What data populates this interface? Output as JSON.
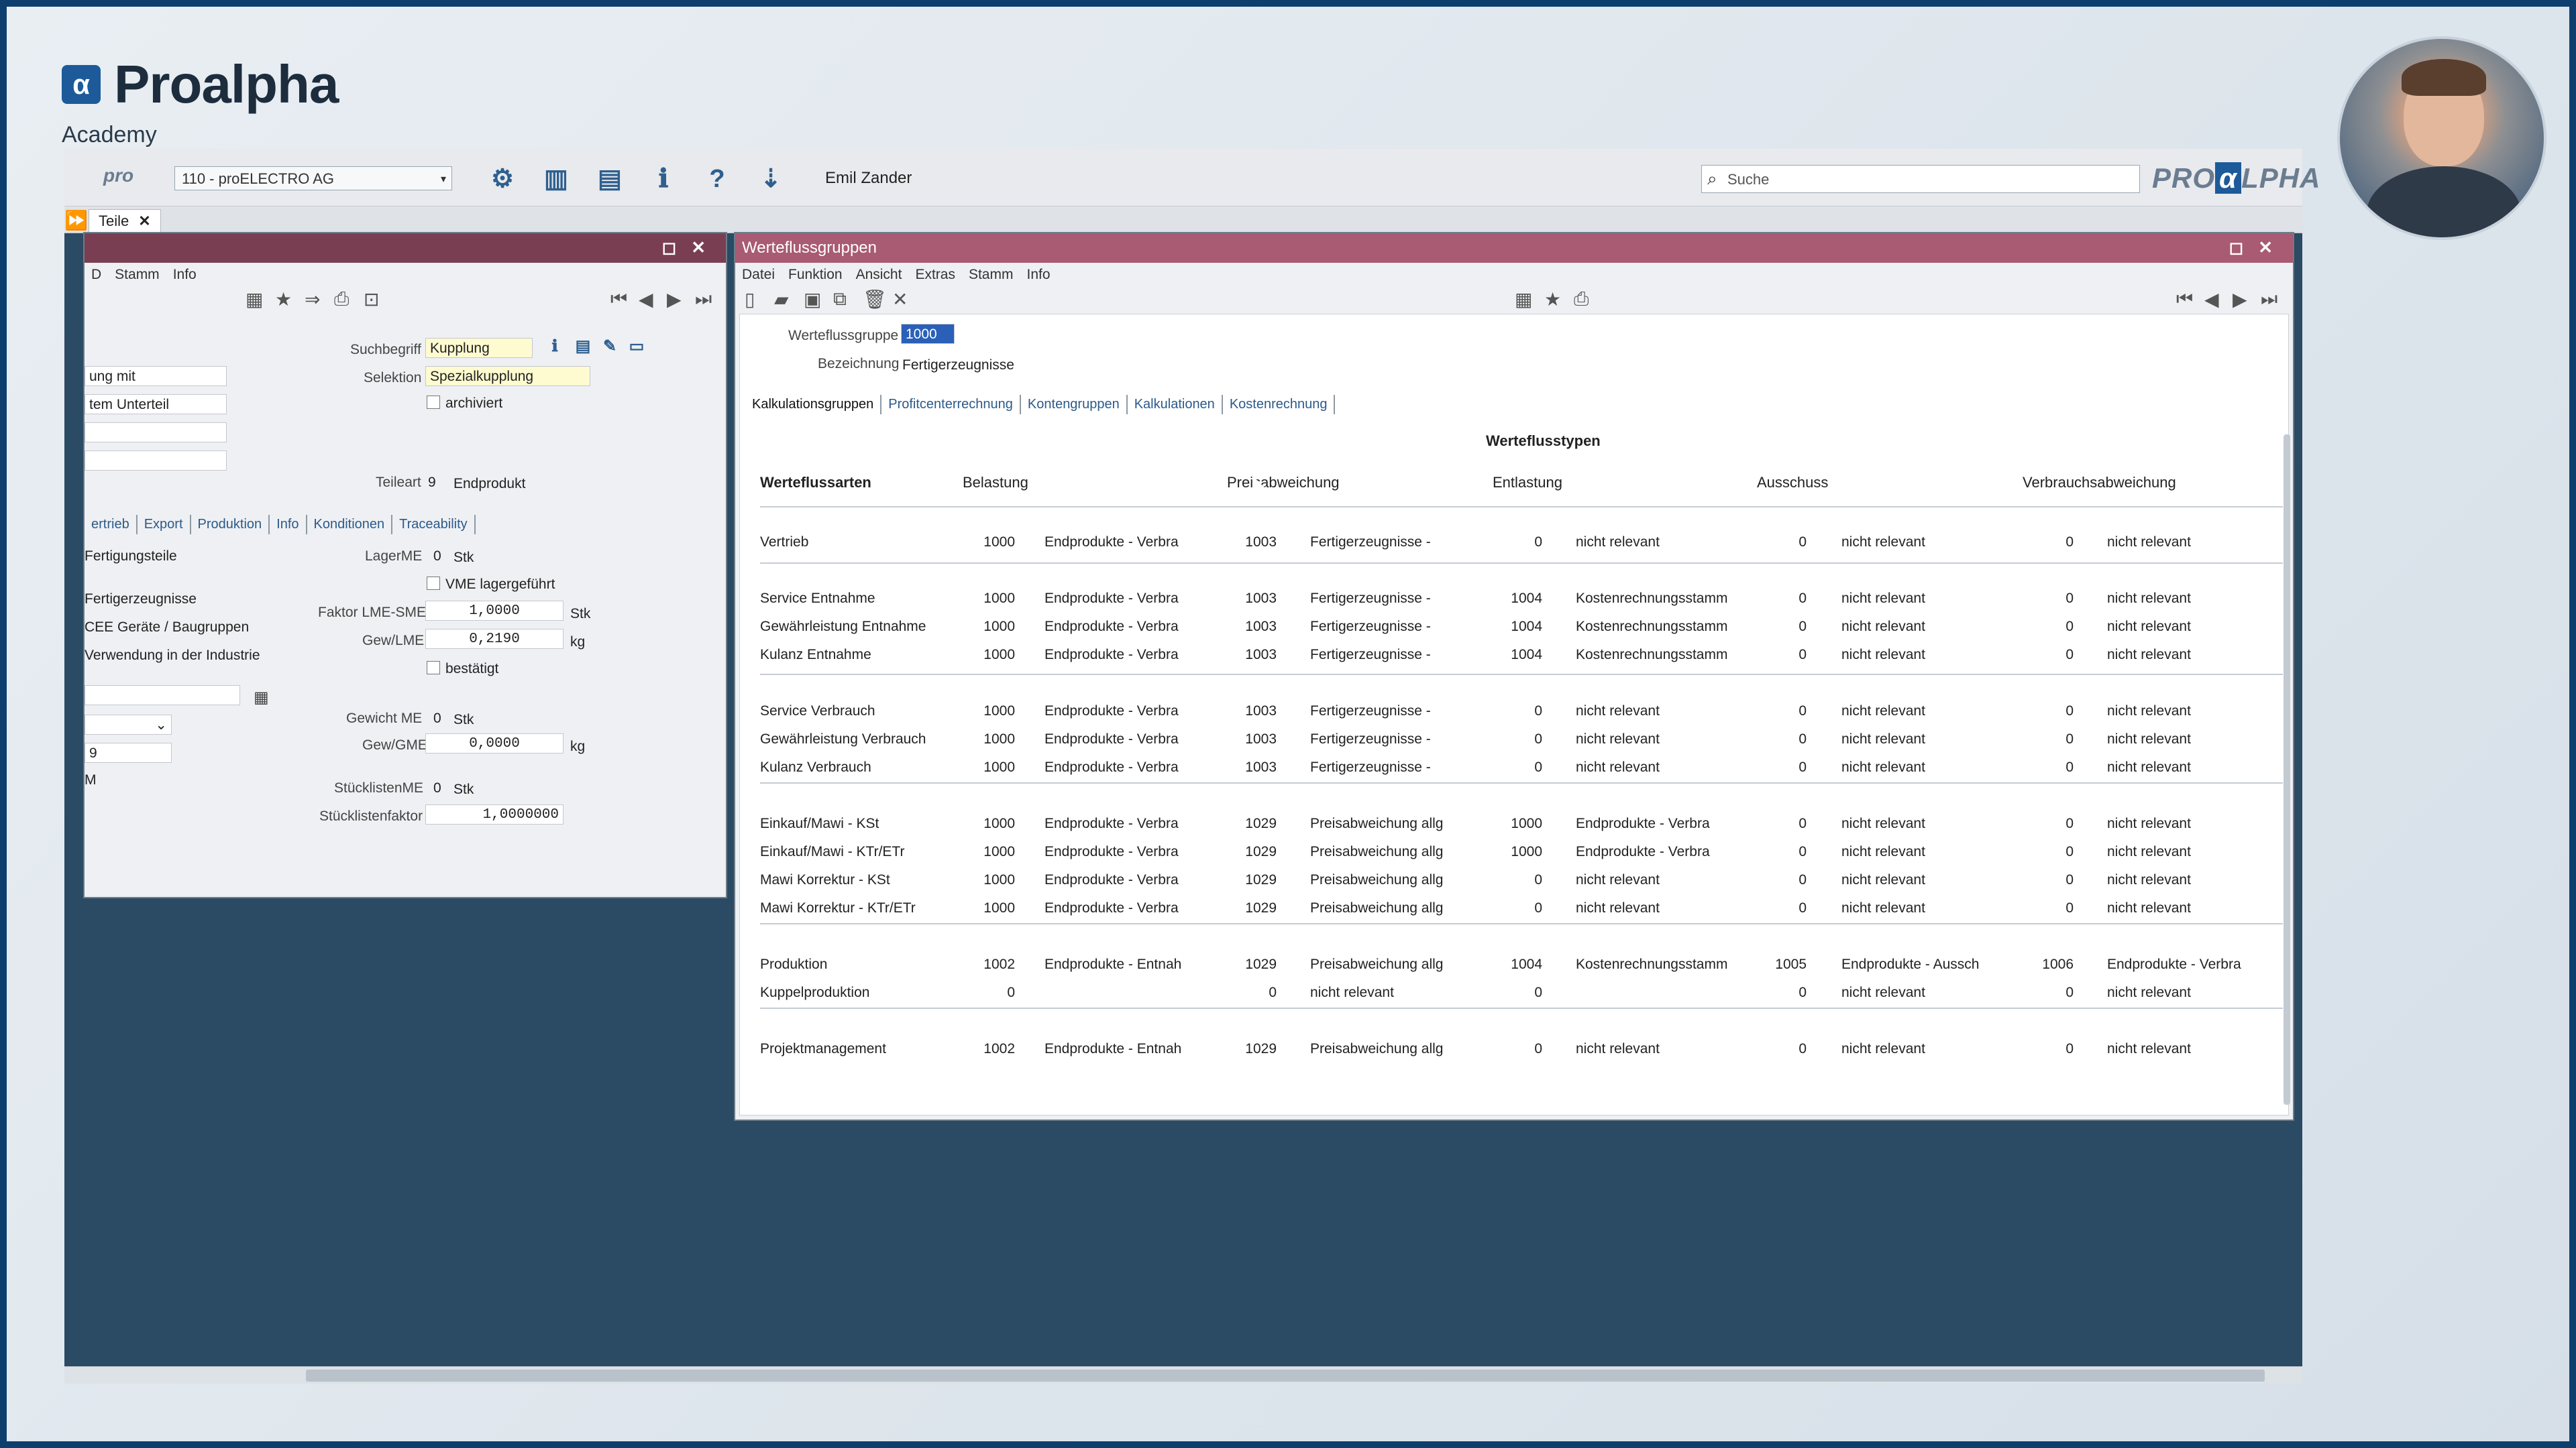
{
  "brand": {
    "name": "Proalpha",
    "sub": "Academy",
    "mark": "α"
  },
  "topbar": {
    "pro_logo": "pro",
    "company": "110 - proELECTRO AG",
    "user": "Emil Zander",
    "search_placeholder": "Suche",
    "proalpha_logo_left": "PRO",
    "proalpha_logo_a": "α",
    "proalpha_logo_right": "LPHA",
    "icons": [
      "gear-icon",
      "panel-icon",
      "layout-icon",
      "info-icon",
      "help-icon",
      "logout-icon"
    ]
  },
  "tabbar": {
    "tab_label": "Teile"
  },
  "left_window": {
    "menu": [
      "D",
      "Stamm",
      "Info"
    ],
    "fields": {
      "suchbegriff_label": "Suchbegriff",
      "suchbegriff": "Kupplung",
      "selektion_label": "Selektion",
      "selektion": "Spezialkupplung",
      "archiviert": "archiviert",
      "left1": "ung mit",
      "left2": "tem Unterteil",
      "teileart_label": "Teileart",
      "teileart_num": "9",
      "teileart": "Endprodukt",
      "lagerme_label": "LagerME",
      "lagerme_num": "0",
      "lagerme_unit": "Stk",
      "vme": "VME lagergeführt",
      "faktor_label": "Faktor LME-SME",
      "faktor": "1,0000",
      "faktor_unit": "Stk",
      "gewlme_label": "Gew/LME",
      "gewlme": "0,2190",
      "gewlme_unit": "kg",
      "bestaetigt": "bestätigt",
      "gewme_label": "Gewicht ME",
      "gewme_num": "0",
      "gewme_unit": "Stk",
      "gewgme_label": "Gew/GME",
      "gewgme": "0,0000",
      "gewgme_unit": "kg",
      "stlme_label": "StücklistenME",
      "stlme_num": "0",
      "stlme_unit": "Stk",
      "stlfaktor_label": "Stücklistenfaktor",
      "stlfaktor": "1,0000000",
      "list1": "Fertigungsteile",
      "list2": "Fertigerzeugnisse",
      "list3": "CEE Geräte / Baugruppen",
      "list4": "Verwendung in der Industrie",
      "short1": "9",
      "short2": "M"
    },
    "subtabs": [
      "ertrieb",
      "Export",
      "Produktion",
      "Info",
      "Konditionen",
      "Traceability"
    ]
  },
  "right_window": {
    "title": "Werteflussgruppen",
    "menu": [
      "Datei",
      "Funktion",
      "Ansicht",
      "Extras",
      "Stamm",
      "Info"
    ],
    "werteflussgruppe_label": "Werteflussgruppe",
    "werteflussgruppe": "1000",
    "bezeichnung_label": "Bezeichnung",
    "bezeichnung": "Fertigerzeugnisse",
    "subtabs": [
      "Kalkulationsgruppen",
      "Profitcenterrechnung",
      "Kontengruppen",
      "Kalkulationen",
      "Kostenrechnung"
    ],
    "section_title": "Werteflusstypen",
    "headers": [
      "Werteflussarten",
      "Belastung",
      "Preisabweichung",
      "Entlastung",
      "Ausschuss",
      "Verbrauchsabweichung"
    ],
    "rows": [
      [
        "Vertrieb",
        "1000",
        "Endprodukte - Verbra",
        "1003",
        "Fertigerzeugnisse -",
        "0",
        "nicht relevant",
        "0",
        "nicht relevant",
        "0",
        "nicht relevant"
      ],
      [
        "Service Entnahme",
        "1000",
        "Endprodukte - Verbra",
        "1003",
        "Fertigerzeugnisse -",
        "1004",
        "Kostenrechnungsstamm",
        "0",
        "nicht relevant",
        "0",
        "nicht relevant"
      ],
      [
        "Gewährleistung Entnahme",
        "1000",
        "Endprodukte - Verbra",
        "1003",
        "Fertigerzeugnisse -",
        "1004",
        "Kostenrechnungsstamm",
        "0",
        "nicht relevant",
        "0",
        "nicht relevant"
      ],
      [
        "Kulanz Entnahme",
        "1000",
        "Endprodukte - Verbra",
        "1003",
        "Fertigerzeugnisse -",
        "1004",
        "Kostenrechnungsstamm",
        "0",
        "nicht relevant",
        "0",
        "nicht relevant"
      ],
      [
        "Service Verbrauch",
        "1000",
        "Endprodukte - Verbra",
        "1003",
        "Fertigerzeugnisse -",
        "0",
        "nicht relevant",
        "0",
        "nicht relevant",
        "0",
        "nicht relevant"
      ],
      [
        "Gewährleistung Verbrauch",
        "1000",
        "Endprodukte - Verbra",
        "1003",
        "Fertigerzeugnisse -",
        "0",
        "nicht relevant",
        "0",
        "nicht relevant",
        "0",
        "nicht relevant"
      ],
      [
        "Kulanz Verbrauch",
        "1000",
        "Endprodukte - Verbra",
        "1003",
        "Fertigerzeugnisse -",
        "0",
        "nicht relevant",
        "0",
        "nicht relevant",
        "0",
        "nicht relevant"
      ],
      [
        "Einkauf/Mawi - KSt",
        "1000",
        "Endprodukte - Verbra",
        "1029",
        "Preisabweichung allg",
        "1000",
        "Endprodukte - Verbra",
        "0",
        "nicht relevant",
        "0",
        "nicht relevant"
      ],
      [
        "Einkauf/Mawi - KTr/ETr",
        "1000",
        "Endprodukte - Verbra",
        "1029",
        "Preisabweichung allg",
        "1000",
        "Endprodukte - Verbra",
        "0",
        "nicht relevant",
        "0",
        "nicht relevant"
      ],
      [
        "Mawi Korrektur - KSt",
        "1000",
        "Endprodukte - Verbra",
        "1029",
        "Preisabweichung allg",
        "0",
        "nicht relevant",
        "0",
        "nicht relevant",
        "0",
        "nicht relevant"
      ],
      [
        "Mawi Korrektur - KTr/ETr",
        "1000",
        "Endprodukte - Verbra",
        "1029",
        "Preisabweichung allg",
        "0",
        "nicht relevant",
        "0",
        "nicht relevant",
        "0",
        "nicht relevant"
      ],
      [
        "Produktion",
        "1002",
        "Endprodukte - Entnah",
        "1029",
        "Preisabweichung allg",
        "1004",
        "Kostenrechnungsstamm",
        "1005",
        "Endprodukte - Aussch",
        "1006",
        "Endprodukte - Verbra"
      ],
      [
        "Kuppelproduktion",
        "0",
        "",
        "0",
        "nicht relevant",
        "0",
        "",
        "0",
        "nicht relevant",
        "0",
        "nicht relevant"
      ],
      [
        "Projektmanagement",
        "1002",
        "Endprodukte - Entnah",
        "1029",
        "Preisabweichung allg",
        "0",
        "nicht relevant",
        "0",
        "nicht relevant",
        "0",
        "nicht relevant"
      ]
    ]
  }
}
